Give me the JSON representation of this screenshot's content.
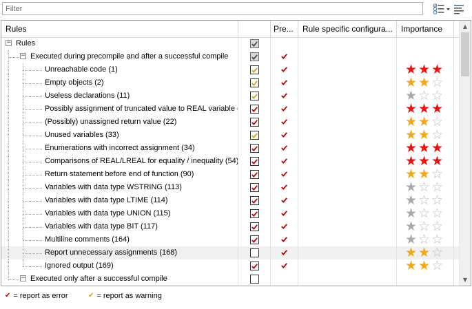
{
  "filter": {
    "placeholder": "Filter",
    "value": ""
  },
  "toolbar": {
    "view_icon": "view-options-icon",
    "sort_icon": "sort-lines-icon"
  },
  "columns": {
    "rules": "Rules",
    "active": "",
    "pre": "Pre...",
    "config": "Rule specific configura...",
    "importance": "Importance"
  },
  "colors": {
    "error": "#c00000",
    "warning": "#d4a017",
    "star_red": "#ee1111",
    "star_gold": "#f2a81d",
    "star_gray": "#aaaaaa"
  },
  "rows": [
    {
      "label": "Rules",
      "level": 0,
      "expander": "−",
      "check": "gray",
      "pre": "",
      "stars": null,
      "highlight": false
    },
    {
      "label": "Executed during precompile and after a successful compile",
      "level": 1,
      "expander": "−",
      "check": "gray",
      "pre": "error",
      "stars": null,
      "highlight": false
    },
    {
      "label": "Unreachable code (1)",
      "level": 2,
      "check": "warning",
      "pre": "error",
      "stars": {
        "filled": 3,
        "color": "red"
      },
      "highlight": false
    },
    {
      "label": "Empty objects (2)",
      "level": 2,
      "check": "warning",
      "pre": "error",
      "stars": {
        "filled": 2,
        "color": "gold"
      },
      "highlight": false
    },
    {
      "label": "Useless declarations (11)",
      "level": 2,
      "check": "warning",
      "pre": "error",
      "stars": {
        "filled": 1,
        "color": "gray"
      },
      "highlight": false
    },
    {
      "label": "Possibly assignment of truncated value to REAL variable (...",
      "level": 2,
      "check": "error",
      "pre": "error",
      "stars": {
        "filled": 3,
        "color": "red"
      },
      "highlight": false
    },
    {
      "label": "(Possibly) unassigned return value (22)",
      "level": 2,
      "check": "error",
      "pre": "error",
      "stars": {
        "filled": 2,
        "color": "gold"
      },
      "highlight": false
    },
    {
      "label": "Unused variables (33)",
      "level": 2,
      "check": "warning",
      "pre": "error",
      "stars": {
        "filled": 2,
        "color": "gold"
      },
      "highlight": false
    },
    {
      "label": "Enumerations with incorrect assignment (34)",
      "level": 2,
      "check": "error",
      "pre": "error",
      "stars": {
        "filled": 3,
        "color": "red"
      },
      "highlight": false
    },
    {
      "label": "Comparisons of REAL/LREAL for equality / inequality (54)",
      "level": 2,
      "check": "error",
      "pre": "error",
      "stars": {
        "filled": 3,
        "color": "red"
      },
      "highlight": false
    },
    {
      "label": "Return statement before end of function (90)",
      "level": 2,
      "check": "error",
      "pre": "error",
      "stars": {
        "filled": 2,
        "color": "gold"
      },
      "highlight": false
    },
    {
      "label": "Variables with data type WSTRING (113)",
      "level": 2,
      "check": "error",
      "pre": "error",
      "stars": {
        "filled": 1,
        "color": "gray"
      },
      "highlight": false
    },
    {
      "label": "Variables with data type LTIME (114)",
      "level": 2,
      "check": "error",
      "pre": "error",
      "stars": {
        "filled": 1,
        "color": "gray"
      },
      "highlight": false
    },
    {
      "label": "Variables with data type UNION (115)",
      "level": 2,
      "check": "error",
      "pre": "error",
      "stars": {
        "filled": 1,
        "color": "gray"
      },
      "highlight": false
    },
    {
      "label": "Variables with data type BIT (117)",
      "level": 2,
      "check": "error",
      "pre": "error",
      "stars": {
        "filled": 1,
        "color": "gray"
      },
      "highlight": false
    },
    {
      "label": "Multiline comments (164)",
      "level": 2,
      "check": "error",
      "pre": "error",
      "stars": {
        "filled": 1,
        "color": "gray"
      },
      "highlight": false
    },
    {
      "label": "Report unnecessary assignments (168)",
      "level": 2,
      "check": "empty",
      "pre": "error",
      "stars": {
        "filled": 2,
        "color": "gold"
      },
      "highlight": true
    },
    {
      "label": "Ignored output (169)",
      "level": 2,
      "check": "error",
      "pre": "error",
      "stars": {
        "filled": 2,
        "color": "gold"
      },
      "highlight": false
    },
    {
      "label": "Executed only after a successful compile",
      "level": 1,
      "expander": "−",
      "check": "empty",
      "pre": "",
      "stars": null,
      "highlight": false
    }
  ],
  "legend": {
    "error_label": "= report as error",
    "warning_label": "= report as warning"
  }
}
